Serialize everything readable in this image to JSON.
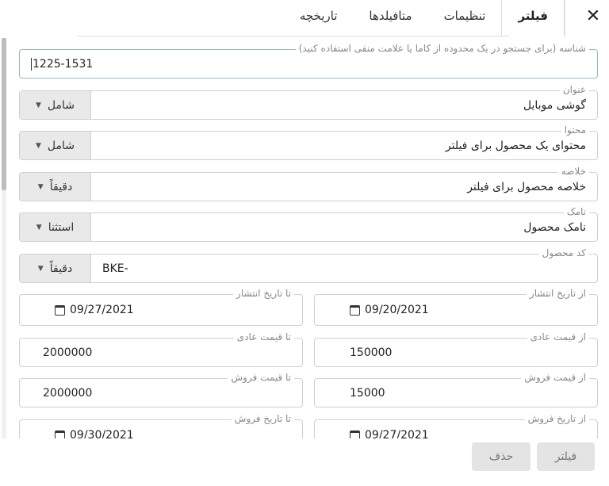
{
  "tabs": [
    {
      "label": "فیلتر",
      "active": true
    },
    {
      "label": "تنظیمات",
      "active": false
    },
    {
      "label": "متافیلدها",
      "active": false
    },
    {
      "label": "تاریخچه",
      "active": false
    }
  ],
  "close_label": "✕",
  "form": {
    "id_field": {
      "legend": "شناسه (برای جستجو در یک محدوده از کاما یا علامت منفی استفاده کنید)",
      "value": "1225-1531"
    },
    "title": {
      "legend": "عنوان",
      "value": "گوشی موبایل",
      "mode": "شامل"
    },
    "content": {
      "legend": "محتوا",
      "value": "محتوای یک محصول برای فیلتر",
      "mode": "شامل"
    },
    "summary": {
      "legend": "خلاصه",
      "value": "خلاصه محصول برای فیلتر",
      "mode": "دقیقاً"
    },
    "slug": {
      "legend": "نامک",
      "value": "نامک محصول",
      "mode": "استثنا"
    },
    "product_code": {
      "legend": "کد محصول",
      "value": "BKE-",
      "mode": "دقیقاً"
    },
    "publish_from": {
      "legend": "از تاریخ انتشار",
      "value": "09/20/2021"
    },
    "publish_to": {
      "legend": "تا تاریخ انتشار",
      "value": "09/27/2021"
    },
    "regular_price_from": {
      "legend": "از قیمت عادی",
      "value": "150000"
    },
    "regular_price_to": {
      "legend": "تا قیمت عادی",
      "value": "2000000"
    },
    "sale_price_from": {
      "legend": "از قیمت فروش",
      "value": "15000"
    },
    "sale_price_to": {
      "legend": "تا قیمت فروش",
      "value": "2000000"
    },
    "sale_date_from": {
      "legend": "از تاریخ فروش",
      "value": "09/27/2021"
    },
    "sale_date_to": {
      "legend": "تا تاریخ فروش",
      "value": "09/30/2021"
    }
  },
  "footer": {
    "filter_label": "فیلتر",
    "delete_label": "حذف"
  },
  "icons": {
    "calendar": "calendar-icon",
    "dropdown": "caret-down-icon",
    "close": "close-icon"
  },
  "colors": {
    "focused_border": "#90b6d8",
    "button_bg": "#e4e4e4",
    "combo_bg": "#e9e9e9"
  }
}
